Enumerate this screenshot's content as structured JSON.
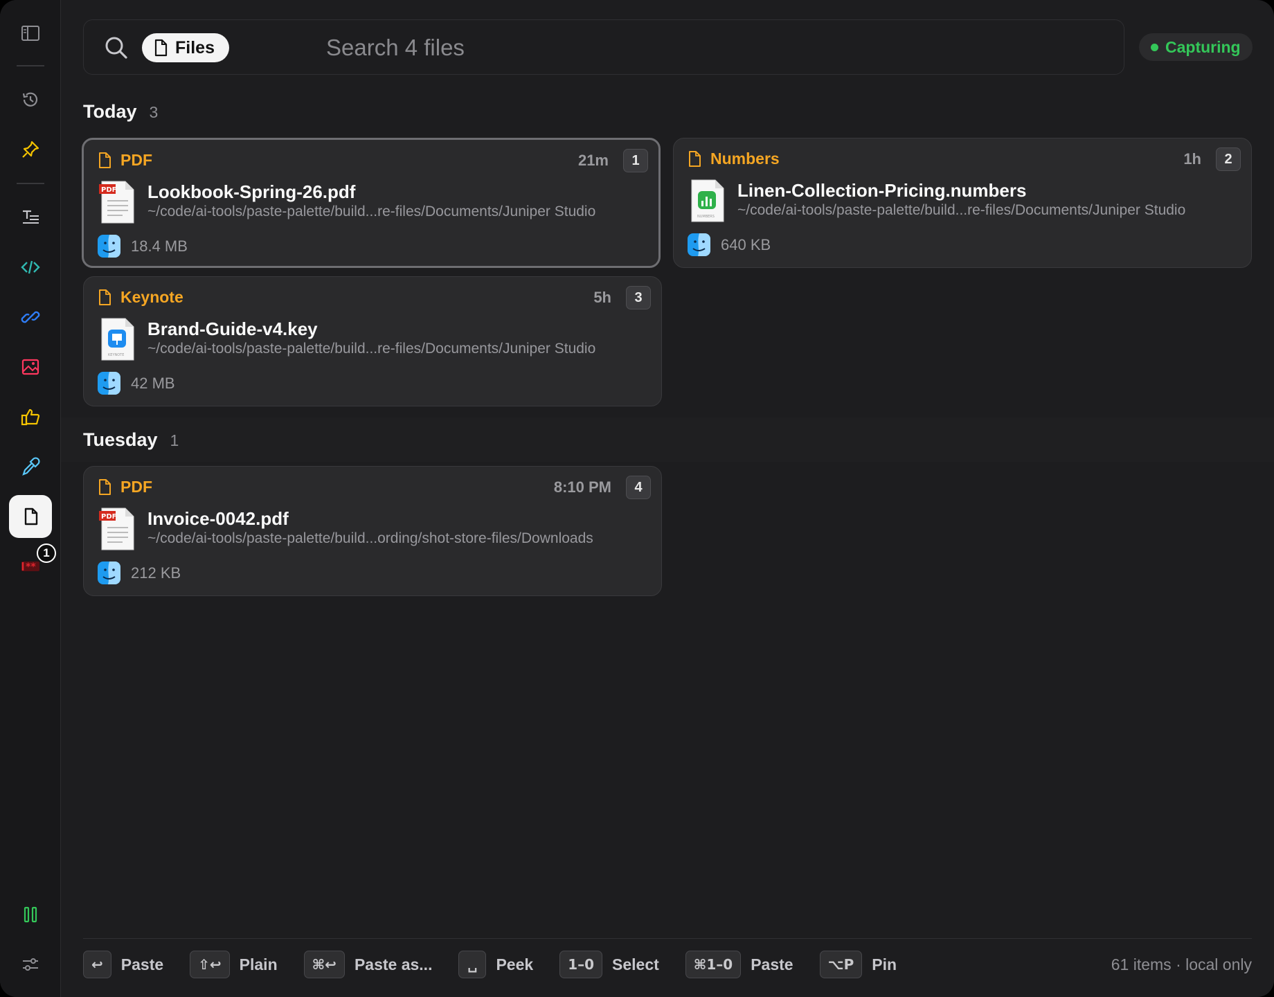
{
  "sidebar": {
    "items": [
      {
        "name": "sidebar-toggle",
        "icon": "sidebar-icon",
        "color": "#8e8e93"
      },
      {
        "name": "history",
        "icon": "history-icon",
        "color": "#8e8e93"
      },
      {
        "name": "pinned",
        "icon": "pin-icon",
        "color": "#f5c400"
      },
      {
        "name": "text",
        "icon": "text-lines-icon",
        "color": "#c7c7cc"
      },
      {
        "name": "code",
        "icon": "code-icon",
        "color": "#30b9b1"
      },
      {
        "name": "links",
        "icon": "link-icon",
        "color": "#2f7df6"
      },
      {
        "name": "images",
        "icon": "image-icon",
        "color": "#ff375f"
      },
      {
        "name": "favorites",
        "icon": "thumbs-up-icon",
        "color": "#f5c400"
      },
      {
        "name": "colors",
        "icon": "eyedropper-icon",
        "color": "#5ac8fa"
      },
      {
        "name": "files",
        "icon": "file-icon",
        "color": "#111111",
        "active": true
      },
      {
        "name": "passwords",
        "icon": "password-icon",
        "color": "#e0262f",
        "badge": "1"
      }
    ],
    "pause_icon": "pause-icon",
    "settings_icon": "sliders-icon"
  },
  "search": {
    "chip_label": "Files",
    "placeholder": "Search 4 files",
    "value": ""
  },
  "capture_status": "Capturing",
  "colors": {
    "accent_orange": "#f5a623",
    "capture_green": "#34c759"
  },
  "sections": [
    {
      "title": "Today",
      "count": "3",
      "cards": [
        {
          "kind": "PDF",
          "time": "21m",
          "index": "1",
          "name": "Lookbook-Spring-26.pdf",
          "path": "~/code/ai-tools/paste-palette/build...re-files/Documents/Juniper Studio",
          "size": "18.4 MB",
          "thumb": "pdf-file-icon",
          "selected": true
        },
        {
          "kind": "Numbers",
          "time": "1h",
          "index": "2",
          "name": "Linen-Collection-Pricing.numbers",
          "path": "~/code/ai-tools/paste-palette/build...re-files/Documents/Juniper Studio",
          "size": "640 KB",
          "thumb": "numbers-file-icon"
        },
        {
          "kind": "Keynote",
          "time": "5h",
          "index": "3",
          "name": "Brand-Guide-v4.key",
          "path": "~/code/ai-tools/paste-palette/build...re-files/Documents/Juniper Studio",
          "size": "42 MB",
          "thumb": "keynote-file-icon"
        }
      ]
    },
    {
      "title": "Tuesday",
      "count": "1",
      "cards": [
        {
          "kind": "PDF",
          "time": "8:10 PM",
          "index": "4",
          "name": "Invoice-0042.pdf",
          "path": "~/code/ai-tools/paste-palette/build...ording/shot-store-files/Downloads",
          "size": "212 KB",
          "thumb": "pdf-file-icon"
        }
      ]
    }
  ],
  "footer": {
    "hints": [
      {
        "key": "↩",
        "label": "Paste"
      },
      {
        "key": "⇧↩",
        "label": "Plain"
      },
      {
        "key": "⌘↩",
        "label": "Paste as..."
      },
      {
        "key": "␣",
        "label": "Peek"
      },
      {
        "key": "1–0",
        "label": "Select"
      },
      {
        "key": "⌘1–0",
        "label": "Paste"
      },
      {
        "key": "⌥P",
        "label": "Pin"
      }
    ],
    "status": "61 items · local only"
  }
}
